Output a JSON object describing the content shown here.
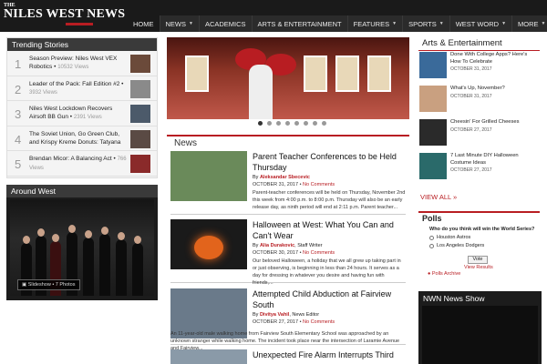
{
  "header": {
    "logo_the": "THE",
    "logo_name": "NILES WEST NEWS",
    "nav": [
      {
        "label": "HOME",
        "caret": false
      },
      {
        "label": "NEWS",
        "caret": true
      },
      {
        "label": "ACADEMICS",
        "caret": false
      },
      {
        "label": "ARTS & ENTERTAINMENT",
        "caret": false
      },
      {
        "label": "FEATURES",
        "caret": true
      },
      {
        "label": "SPORTS",
        "caret": true
      },
      {
        "label": "WEST WORD",
        "caret": true
      },
      {
        "label": "MORE",
        "caret": true
      }
    ],
    "caret_glyph": "▼"
  },
  "trending": {
    "title": "Trending Stories",
    "items": [
      {
        "num": "1",
        "title": "Season Preview: Niles West VEX Robotics",
        "views": "10532 Views"
      },
      {
        "num": "2",
        "title": "Leader of the Pack: Fall Edition #2",
        "views": "3932 Views"
      },
      {
        "num": "3",
        "title": "Niles West Lockdown Recovers Airsoft BB Gun",
        "views": "2391 Views"
      },
      {
        "num": "4",
        "title": "The Soviet Union, Go Green Club, and Krispy Kreme Donuts: Tatyana",
        "views": ""
      },
      {
        "num": "5",
        "title": "Brendan Micor: A Balancing Act",
        "views": "766 Views"
      }
    ]
  },
  "around_west": {
    "title": "Around West",
    "slideshow_label": "Slideshow • 7 Photos"
  },
  "hero": {
    "dots": 8,
    "active_dot": 0
  },
  "news": {
    "title": "News",
    "articles": [
      {
        "title": "Parent Teacher Conferences to be Held Thursday",
        "by": "By",
        "author": "Aleksandar Sbecevic",
        "role": "",
        "date": "OCTOBER 31, 2017",
        "comments": "No Comments",
        "excerpt": "Parent-teacher conferences will be held on Thursday, November 2nd this week from 4:00 p.m. to 8:00 p.m. Thursday will also be an early release day, as ninth period will end at 2:11 p.m. Parent teacher..."
      },
      {
        "title": "Halloween at West: What You Can and Can't Wear",
        "by": "By",
        "author": "Alia Durakovic",
        "role": "Staff Writer",
        "date": "OCTOBER 30, 2017",
        "comments": "No Comments",
        "excerpt": "Our beloved Halloween, a holiday that we all grew up taking part in or just observing, is beginning in less than 24 hours. It serves as a day for dressing in whatever you desire and having fun with friends,..."
      },
      {
        "title": "Attempted Child Abduction at Fairview South",
        "by": "By",
        "author": "Divitya Vahil",
        "role": "News Editor",
        "date": "OCTOBER 27, 2017",
        "comments": "No Comments",
        "excerpt": "An 11-year-old male walking home from Fairview South Elementary School was approached by an unknown stranger while walking home. The incident took place near the intersection of Laramie Avenue and Fairview..."
      },
      {
        "title": "Unexpected Fire Alarm Interrupts Third",
        "by": "",
        "author": "",
        "role": "",
        "date": "",
        "comments": "",
        "excerpt": ""
      }
    ]
  },
  "arts": {
    "title": "Arts & Entertainment",
    "items": [
      {
        "title": "Done With College Apps? Here's How To Celebrate",
        "date": "OCTOBER 31, 2017"
      },
      {
        "title": "What's Up, November?",
        "date": "OCTOBER 31, 2017"
      },
      {
        "title": "Cheesin' For Grilled Cheeses",
        "date": "OCTOBER 27, 2017"
      },
      {
        "title": "7 Last Minute DIY Halloween Costume Ideas",
        "date": "OCTOBER 27, 2017"
      }
    ],
    "view_all": "VIEW ALL »"
  },
  "polls": {
    "title": "Polls",
    "question": "Who do you think will win the World Series?",
    "options": [
      "Houston Astros",
      "Los Angeles Dodgers"
    ],
    "vote_label": "Vote",
    "view_results": "View Results",
    "archive": "Polls Archive"
  },
  "nwn": {
    "title": "NWN News Show"
  },
  "colors": {
    "accent": "#b81d22",
    "header_bg": "#1a1a1a",
    "nav_bg": "#2b2b2b",
    "box_title_bg": "#3a3a3a"
  }
}
